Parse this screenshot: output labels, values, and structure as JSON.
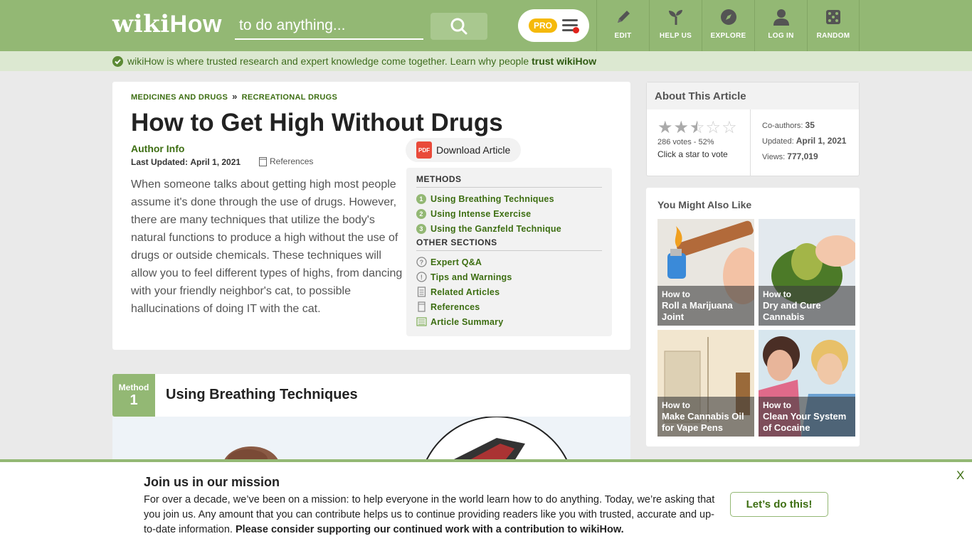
{
  "header": {
    "logo_wiki": "wiki",
    "logo_how": "How",
    "search_placeholder": "to do anything...",
    "pro_label": "PRO",
    "nav": [
      {
        "label": "EDIT",
        "icon": "pencil-icon"
      },
      {
        "label": "HELP US",
        "icon": "sprout-icon"
      },
      {
        "label": "EXPLORE",
        "icon": "compass-icon"
      },
      {
        "label": "LOG IN",
        "icon": "user-icon"
      },
      {
        "label": "RANDOM",
        "icon": "dice-icon"
      }
    ],
    "colors": {
      "brand": "#93b874",
      "accent_dark": "#3d6e12"
    }
  },
  "trust": {
    "text": "wikiHow is where trusted research and expert knowledge come together. Learn why people ",
    "link": "trust wikiHow"
  },
  "article": {
    "breadcrumbs": [
      "MEDICINES AND DRUGS",
      "RECREATIONAL DRUGS"
    ],
    "breadcrumb_sep": "»",
    "title": "How to Get High Without Drugs",
    "author_info": "Author Info",
    "last_updated_label": "Last Updated:",
    "last_updated_date": "April 1, 2021",
    "references_label": "References",
    "download_label": "Download Article",
    "pdf_label": "PDF",
    "intro": "When someone talks about getting high most people assume it's done through the use of drugs. However, there are many techniques that utilize the body's natural functions to produce a high without the use of drugs or outside chemicals. These techniques will allow you to feel different types of highs, from dancing with your friendly neighbor's cat, to possible hallucinations of doing IT with the cat."
  },
  "toc": {
    "methods_heading": "METHODS",
    "methods": [
      {
        "num": "1",
        "label": "Using Breathing Techniques"
      },
      {
        "num": "2",
        "label": "Using Intense Exercise"
      },
      {
        "num": "3",
        "label": "Using the Ganzfeld Technique"
      }
    ],
    "other_heading": "OTHER SECTIONS",
    "other": [
      {
        "icon": "question-circle-icon",
        "label": "Expert Q&A"
      },
      {
        "icon": "exclamation-circle-icon",
        "label": "Tips and Warnings"
      },
      {
        "icon": "document-icon",
        "label": "Related Articles"
      },
      {
        "icon": "bookmark-icon",
        "label": "References"
      },
      {
        "icon": "summary-icon",
        "label": "Article Summary"
      }
    ]
  },
  "method": {
    "badge_label": "Method",
    "badge_num": "1",
    "title": "Using Breathing Techniques"
  },
  "about": {
    "heading": "About This Article",
    "rating": 2.5,
    "rating_max": 5,
    "votes": "286 votes - 52%",
    "vote_cta": "Click a star to vote",
    "coauthors_label": "Co-authors:",
    "coauthors": "35",
    "updated_label": "Updated:",
    "updated": "April 1, 2021",
    "views_label": "Views:",
    "views": "777,019"
  },
  "also_like": {
    "heading": "You Might Also Like",
    "howto": "How to",
    "items": [
      {
        "title": "Roll a Marijuana Joint"
      },
      {
        "title": "Dry and Cure Cannabis"
      },
      {
        "title": "Make Cannabis Oil for Vape Pens"
      },
      {
        "title": "Clean Your System of Cocaine"
      }
    ]
  },
  "banner": {
    "title": "Join us in our mission",
    "text": "For over a decade, we’ve been on a mission: to help everyone in the world learn how to do anything. Today, we’re asking that you join us. Any amount that you can contribute helps us to continue providing readers like you with trusted, accurate and up-to-date information. ",
    "bold": "Please consider supporting our continued work with a contribution to wikiHow.",
    "button": "Let’s do this!",
    "close": "X"
  }
}
